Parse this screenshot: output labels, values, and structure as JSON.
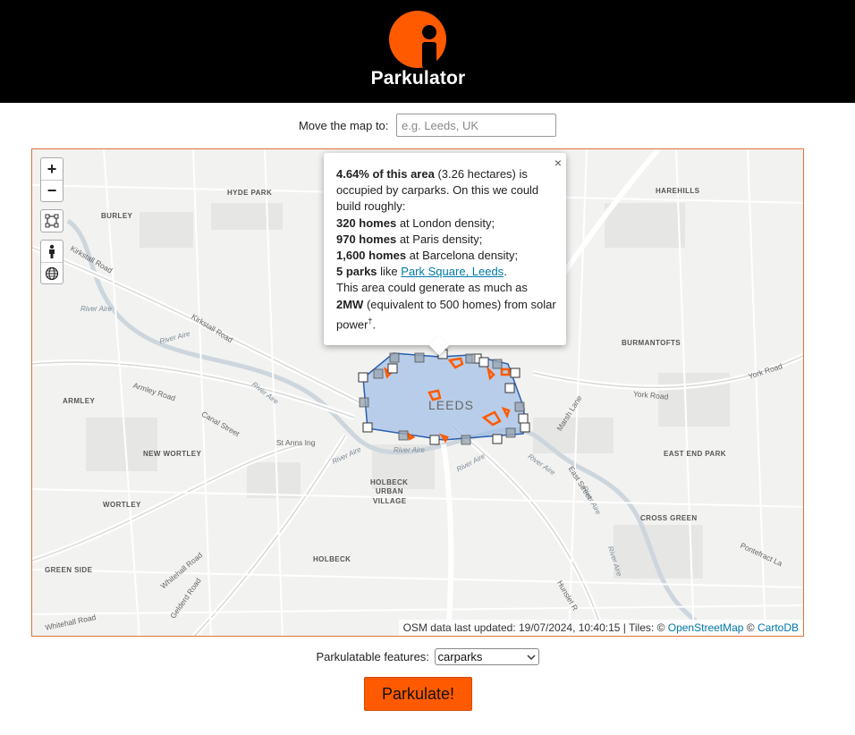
{
  "brand": {
    "name": "Parkulator",
    "logo_icon": "info-person-icon",
    "accent_color": "#ff5a00"
  },
  "search": {
    "label": "Move the map to:",
    "placeholder": "e.g. Leeds, UK",
    "value": ""
  },
  "map": {
    "controls": {
      "zoom_in": "+",
      "zoom_out": "−",
      "draw_icon": "polygon-draw-icon",
      "person_icon": "pegman-icon",
      "globe_icon": "globe-icon"
    },
    "place_labels": [
      "HYDE PARK",
      "HAREHILLS",
      "BURLEY",
      "BURMANTOFTS",
      "ARMLEY",
      "NEW WORTLEY",
      "EAST END PARK",
      "HOLBECK",
      "URBAN",
      "VILLAGE",
      "WORTLEY",
      "CROSS GREEN",
      "GREEN SIDE",
      "HOLBECK"
    ],
    "city_label": "LEEDS",
    "road_labels": [
      "Kirkstall Road",
      "Kirkstall Road",
      "Armley Road",
      "Canal Street",
      "St Anns Ing",
      "York Road",
      "York Road",
      "Marsh Lane",
      "East Street",
      "Whitehall Road",
      "Whitehall Road",
      "Gelderd Road",
      "Pontefract La",
      "Hunslet R"
    ],
    "river_labels": [
      "River Aire",
      "River Aire",
      "River Aire",
      "River Aire",
      "River Aire",
      "River Aire",
      "River Aire",
      "River Aire",
      "River Aire"
    ],
    "polygon_fill": "#9fbde6",
    "polygon_stroke": "#2a5fb0",
    "carpark_color": "#ff5a00",
    "popup": {
      "close": "×",
      "headline_bold": "4.64% of this area",
      "headline_rest": " (3.26 hectares) is occupied by carparks. On this we could build roughly:",
      "london_bold": "320 homes",
      "london_rest": " at London density;",
      "paris_bold": "970 homes",
      "paris_rest": " at Paris density;",
      "barcelona_bold": "1,600 homes",
      "barcelona_rest": " at Barcelona density;",
      "parks_bold": "5 parks",
      "parks_like": " like ",
      "parks_link": "Park Square, Leeds",
      "parks_end": ".",
      "solar_start": "This area could generate as much as ",
      "solar_bold": "2MW",
      "solar_rest": " (equivalent to 500 homes) from solar power",
      "dagger": "†",
      "solar_end": "."
    },
    "attribution": {
      "updated": "OSM data last updated: 19/07/2024, 10:40:15 | Tiles: © ",
      "osm_link": "OpenStreetMap",
      "copy": " © ",
      "carto_link": "CartoDB"
    }
  },
  "features": {
    "label": "Parkulatable features:",
    "selected": "carparks"
  },
  "submit": {
    "label": "Parkulate!"
  }
}
